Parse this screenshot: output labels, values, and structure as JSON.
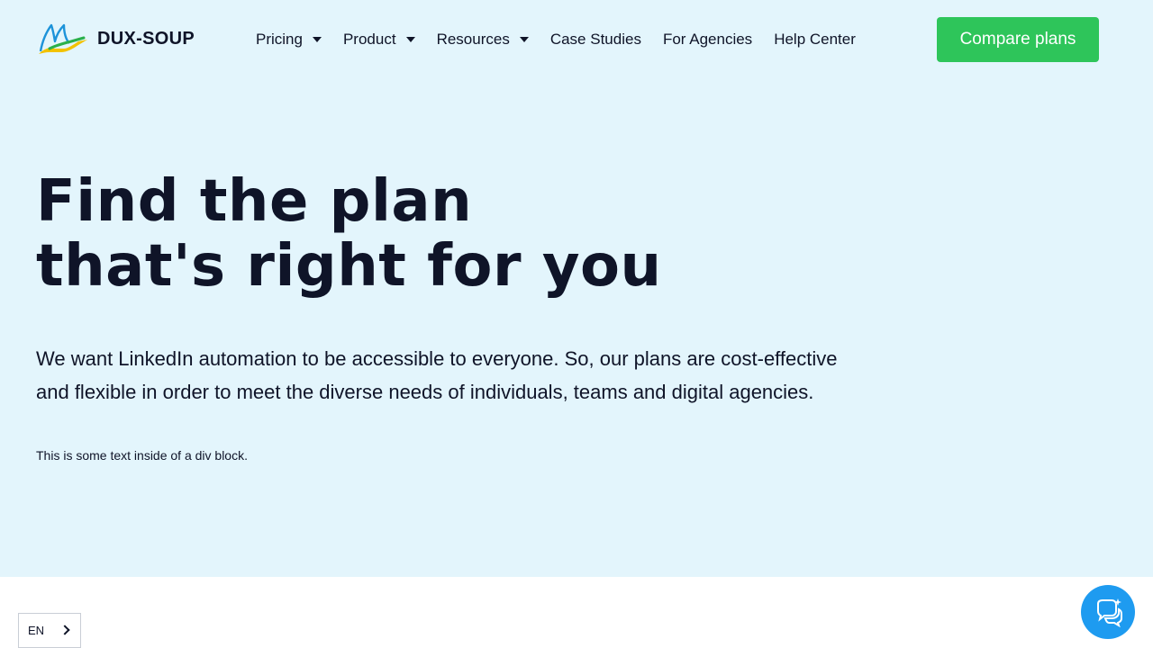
{
  "brand": {
    "name": "DUX-SOUP",
    "colors": {
      "hero_bg": "#e3f5fc",
      "cta": "#2ec55a",
      "chat": "#1e9bf0",
      "text": "#0f1428"
    }
  },
  "nav": {
    "items": [
      {
        "label": "Pricing",
        "has_dropdown": true
      },
      {
        "label": "Product",
        "has_dropdown": true
      },
      {
        "label": "Resources",
        "has_dropdown": true
      },
      {
        "label": "Case Studies",
        "has_dropdown": false
      },
      {
        "label": "For Agencies",
        "has_dropdown": false
      },
      {
        "label": "Help Center",
        "has_dropdown": false
      }
    ],
    "cta_label": "Compare plans"
  },
  "hero": {
    "title_line1": "Find the plan",
    "title_line2": "that's right for you",
    "description": "We want LinkedIn automation to be accessible to everyone. So, our plans are cost-effective and flexible in order to meet the diverse needs of individuals, teams and digital agencies.",
    "note": "This is some text inside of a div block."
  },
  "language_selector": {
    "value": "EN",
    "icon": "chevron-right-icon"
  },
  "chat_widget": {
    "icon": "chat-bubbles-icon"
  }
}
